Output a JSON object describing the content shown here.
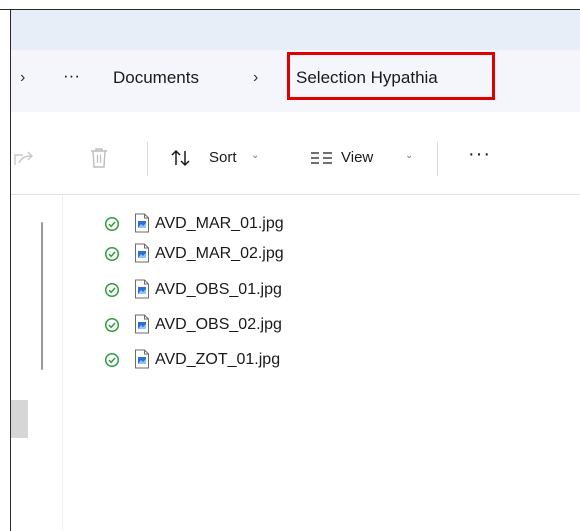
{
  "breadcrumb": {
    "more": "···",
    "items": [
      "Documents",
      "Selection Hypathia"
    ],
    "separator": "›"
  },
  "toolbar": {
    "sort_label": "Sort",
    "view_label": "View",
    "more": "···"
  },
  "files": [
    {
      "name": "AVD_MAR_01.jpg",
      "status": "synced"
    },
    {
      "name": "AVD_MAR_02.jpg",
      "status": "synced"
    },
    {
      "name": "AVD_OBS_01.jpg",
      "status": "synced"
    },
    {
      "name": "AVD_OBS_02.jpg",
      "status": "synced"
    },
    {
      "name": "AVD_ZOT_01.jpg",
      "status": "synced"
    }
  ],
  "colors": {
    "highlight_border": "#e00000",
    "status_green": "#2e9d3c",
    "file_icon_blue": "#2b6fd6"
  }
}
